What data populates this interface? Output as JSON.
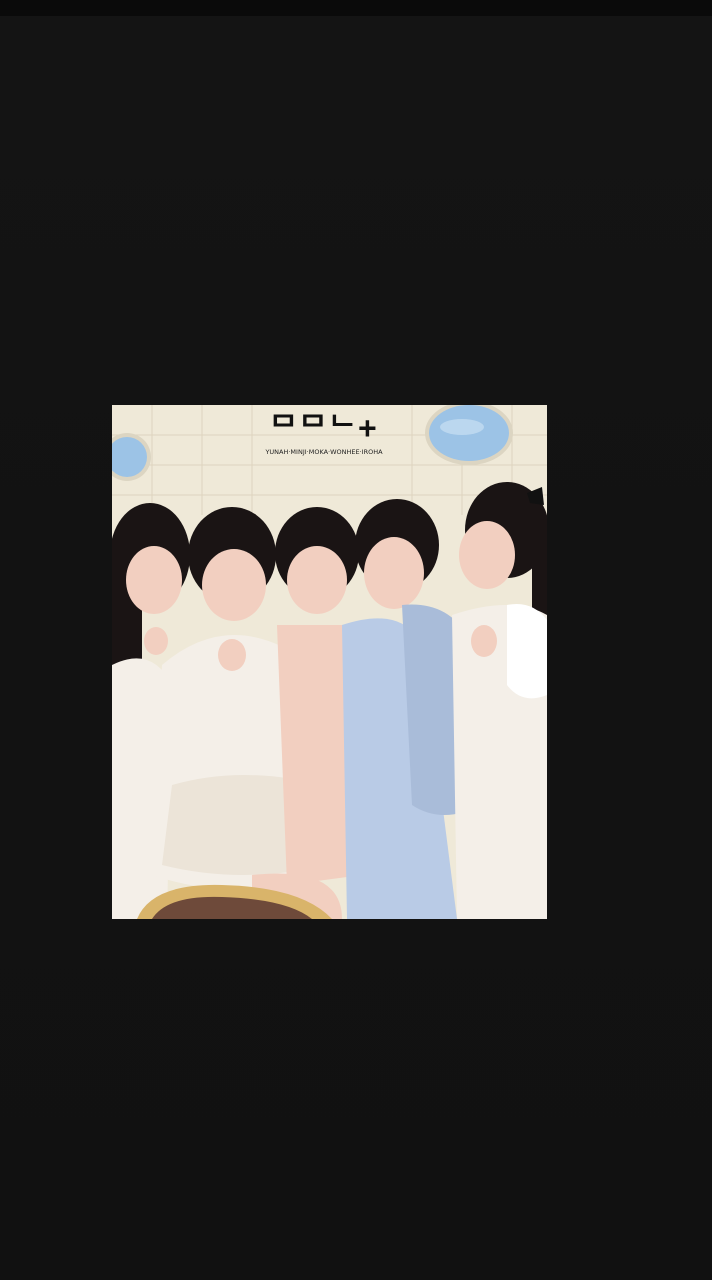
{
  "viewer": {
    "background_color": "#111111",
    "status_bar_color": "#0a0a0a"
  },
  "photo": {
    "logo_mark": "ᄆᄆᄂ+",
    "logo_members": "YUNAH·MINJI·MOKA·WONHEE·IROHA",
    "people_count": 5,
    "colors": {
      "wall": "#efe9d8",
      "window_sky": "#9cc3e6",
      "hair": "#1a1414",
      "skin": "#f2cfc0",
      "white_dress": "#f4efe8",
      "blue_dress": "#b9cbe6",
      "chair_frame": "#d9b46a"
    }
  }
}
